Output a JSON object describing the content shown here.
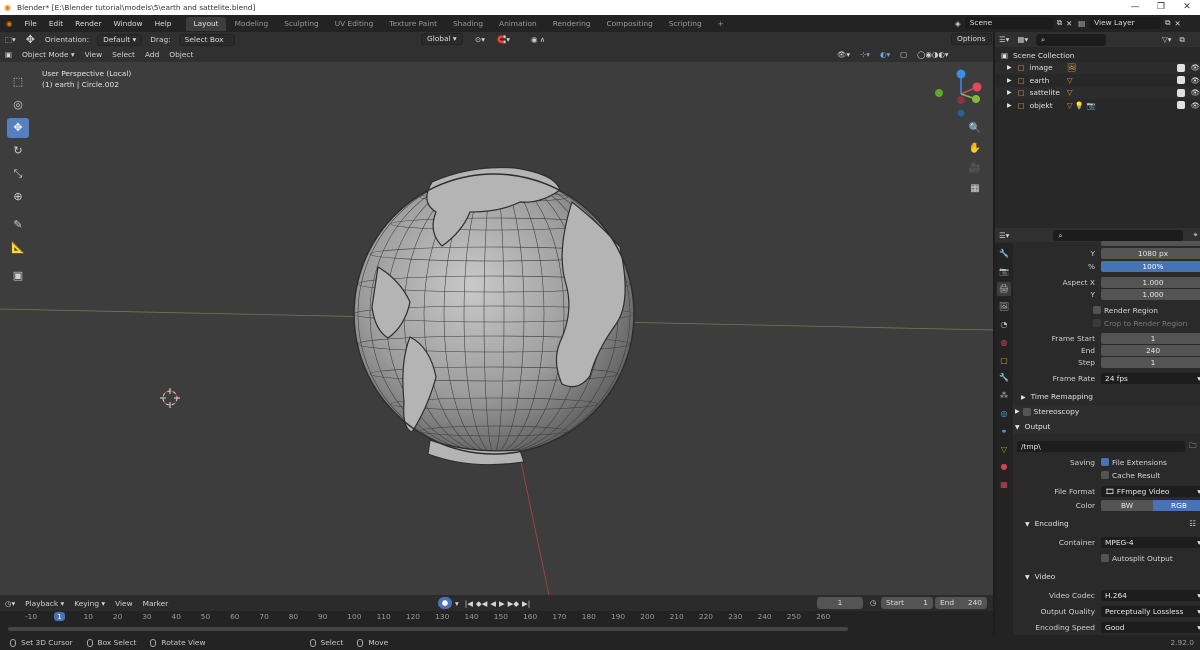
{
  "window": {
    "title": "Blender* [E:\\Blender tutorial\\models\\5\\earth and sattelite.blend]",
    "controls": [
      "—",
      "❐",
      "✕"
    ]
  },
  "topbar": {
    "menus": [
      "File",
      "Edit",
      "Render",
      "Window",
      "Help"
    ],
    "workspaces": [
      "Layout",
      "Modeling",
      "Sculpting",
      "UV Editing",
      "Texture Paint",
      "Shading",
      "Animation",
      "Rendering",
      "Compositing",
      "Scripting"
    ],
    "active_workspace": "Layout",
    "add_tab": "+",
    "scene": "Scene",
    "view_layer": "View Layer"
  },
  "tool_header": {
    "orientation_label": "Orientation:",
    "orientation_value": "Default",
    "drag_label": "Drag:",
    "drag_value": "Select Box",
    "transform_space": "Global",
    "options": "Options"
  },
  "viewport_header": {
    "mode": "Object Mode",
    "menus": [
      "View",
      "Select",
      "Add",
      "Object"
    ]
  },
  "viewport": {
    "perspective": "User Perspective (Local)",
    "active_object": "(1) earth | Circle.002",
    "gizmo_axes": [
      "X",
      "Y",
      "Z"
    ]
  },
  "tools": [
    {
      "name": "select-box-tool",
      "glyph": "⬚"
    },
    {
      "name": "cursor-tool",
      "glyph": "◎"
    },
    {
      "name": "move-tool",
      "glyph": "✥"
    },
    {
      "name": "rotate-tool",
      "glyph": "↻"
    },
    {
      "name": "scale-tool",
      "glyph": "⤡"
    },
    {
      "name": "transform-tool",
      "glyph": "⊕"
    },
    {
      "name": "annotate-tool",
      "glyph": "✎"
    },
    {
      "name": "measure-tool",
      "glyph": "📐"
    },
    {
      "name": "add-cube-tool",
      "glyph": "▣"
    }
  ],
  "navigation": [
    "🔍",
    "✋",
    "🎥",
    "▦"
  ],
  "outliner": {
    "search_placeholder": "",
    "root": "Scene Collection",
    "items": [
      {
        "label": "image",
        "icons": "🖼"
      },
      {
        "label": "earth",
        "icons": "▽"
      },
      {
        "label": "sattelite",
        "icons": "▽"
      },
      {
        "label": "objekt",
        "icons": "▽ 💡 📷"
      }
    ]
  },
  "properties": {
    "resolution_y_label": "Y",
    "resolution_y": "1080 px",
    "resolution_pct_label": "%",
    "resolution_pct": "100%",
    "aspect_x_label": "Aspect X",
    "aspect_x": "1.000",
    "aspect_y_label": "Y",
    "aspect_y": "1.000",
    "render_region": "Render Region",
    "crop_region": "Crop to Render Region",
    "frame_start_label": "Frame Start",
    "frame_start": "1",
    "frame_end_label": "End",
    "frame_end": "240",
    "frame_step_label": "Step",
    "frame_step": "1",
    "frame_rate_label": "Frame Rate",
    "frame_rate": "24 fps",
    "time_remapping": "Time Remapping",
    "stereoscopy": "Stereoscopy",
    "output": "Output",
    "output_path": "/tmp\\",
    "saving_label": "Saving",
    "file_extensions": "File Extensions",
    "cache_result": "Cache Result",
    "file_format_label": "File Format",
    "file_format": "FFmpeg Video",
    "color_label": "Color",
    "color_bw": "BW",
    "color_rgb": "RGB",
    "encoding": "Encoding",
    "container_label": "Container",
    "container": "MPEG-4",
    "autosplit": "Autosplit Output",
    "video": "Video",
    "video_codec_label": "Video Codec",
    "video_codec": "H.264",
    "output_quality_label": "Output Quality",
    "output_quality": "Perceptually Lossless",
    "encoding_speed_label": "Encoding Speed",
    "encoding_speed": "Good"
  },
  "timeline": {
    "menus": [
      "Playback",
      "Keying",
      "View",
      "Marker"
    ],
    "current_frame": "1",
    "start_label": "Start",
    "start": "1",
    "end_label": "End",
    "end": "240",
    "ruler": [
      "-10",
      "1",
      "20",
      "40",
      "60",
      "80",
      "100",
      "120",
      "140",
      "160",
      "180",
      "200",
      "220",
      "240",
      "260",
      "10",
      "30",
      "50",
      "70",
      "90",
      "110",
      "130",
      "150",
      "170",
      "190",
      "210",
      "230",
      "250"
    ]
  },
  "ruler_labels": [
    "-10",
    "1",
    "10",
    "20",
    "30",
    "40",
    "50",
    "60",
    "70",
    "80",
    "90",
    "100",
    "110",
    "120",
    "130",
    "140",
    "150",
    "160",
    "170",
    "180",
    "190",
    "200",
    "210",
    "220",
    "230",
    "240",
    "250",
    "260"
  ],
  "statusbar": {
    "items": [
      "Set 3D Cursor",
      "Box Select",
      "Rotate View",
      "Select",
      "Move"
    ],
    "version": "2.92.0"
  },
  "colors": {
    "accent": "#4772b3",
    "active_tool": "#5680c2",
    "viewport_bg": "#3d3d3d",
    "x_axis": "#e2495a",
    "y_axis": "#7fba3c",
    "z_axis": "#3d8ee0"
  }
}
